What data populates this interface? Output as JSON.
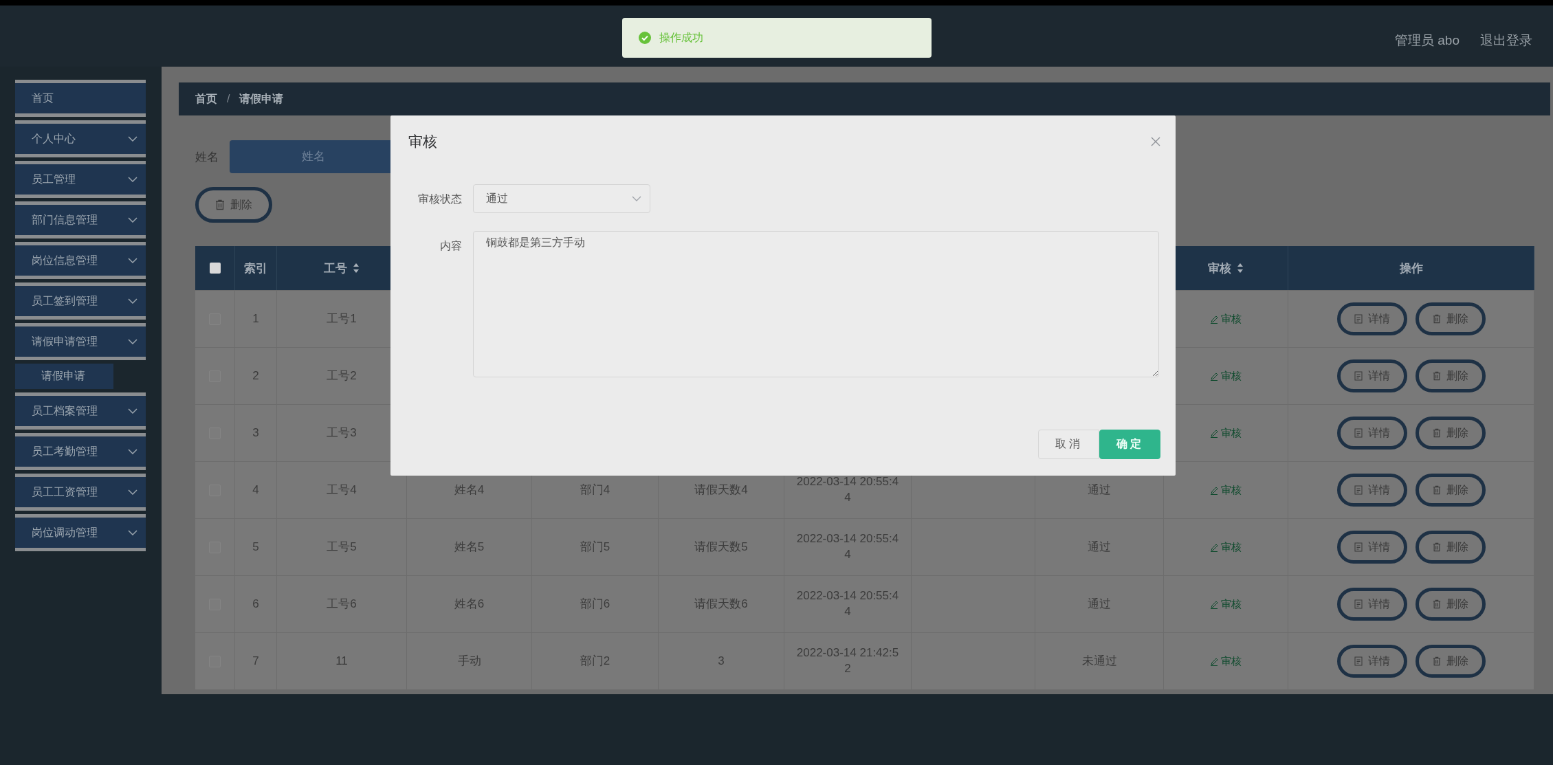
{
  "toast": {
    "message": "操作成功"
  },
  "header": {
    "user": "管理员 abo",
    "logout": "退出登录"
  },
  "sidebar": {
    "items": [
      {
        "label": "首页",
        "kind": "link"
      },
      {
        "label": "个人中心",
        "kind": "submenu"
      },
      {
        "label": "员工管理",
        "kind": "submenu"
      },
      {
        "label": "部门信息管理",
        "kind": "submenu"
      },
      {
        "label": "岗位信息管理",
        "kind": "submenu"
      },
      {
        "label": "员工签到管理",
        "kind": "submenu"
      },
      {
        "label": "请假申请管理",
        "kind": "submenu",
        "children": [
          {
            "label": "请假申请",
            "selected": true
          }
        ]
      },
      {
        "label": "员工档案管理",
        "kind": "submenu"
      },
      {
        "label": "员工考勤管理",
        "kind": "submenu"
      },
      {
        "label": "员工工资管理",
        "kind": "submenu"
      },
      {
        "label": "岗位调动管理",
        "kind": "submenu"
      }
    ]
  },
  "breadcrumb": {
    "items": [
      "首页",
      "请假申请"
    ],
    "separator": "/"
  },
  "search": {
    "label": "姓名",
    "placeholder": "姓名"
  },
  "toolbar": {
    "delete_button": "删除"
  },
  "table": {
    "header_checkbox": {
      "checked": false
    },
    "columns_left": [
      {
        "label": "索引",
        "sortable": false
      },
      {
        "label": "工号",
        "sortable": true
      }
    ],
    "columns_right": [
      {
        "label": "审核",
        "sortable": true
      },
      {
        "label": "操作",
        "sortable": false
      }
    ],
    "rows": [
      {
        "selected": false,
        "index": "1",
        "job_no": "工号1",
        "review": "审核",
        "detail": "详情",
        "delete": "删除"
      },
      {
        "selected": false,
        "index": "2",
        "job_no": "工号2",
        "review": "审核",
        "detail": "详情",
        "delete": "删除"
      },
      {
        "selected": false,
        "index": "3",
        "job_no": "工号3",
        "review": "审核",
        "detail": "详情",
        "delete": "删除"
      },
      {
        "selected": false,
        "index": "4",
        "job_no": "工号4",
        "name": "姓名4",
        "department": "部门4",
        "leave_days": "请假天数4",
        "apply_time": "2022-03-14 20:55:44",
        "status": "通过",
        "review": "审核",
        "detail": "详情",
        "delete": "删除"
      },
      {
        "selected": false,
        "index": "5",
        "job_no": "工号5",
        "name": "姓名5",
        "department": "部门5",
        "leave_days": "请假天数5",
        "apply_time": "2022-03-14 20:55:44",
        "status": "通过",
        "review": "审核",
        "detail": "详情",
        "delete": "删除"
      },
      {
        "selected": false,
        "index": "6",
        "job_no": "工号6",
        "name": "姓名6",
        "department": "部门6",
        "leave_days": "请假天数6",
        "apply_time": "2022-03-14 20:55:44",
        "status": "通过",
        "review": "审核",
        "detail": "详情",
        "delete": "删除"
      },
      {
        "selected": false,
        "index": "7",
        "job_no": "11",
        "name": "手动",
        "department": "部门2",
        "leave_days": "3",
        "apply_time": "2022-03-14 21:42:52",
        "status": "未通过",
        "review": "审核",
        "detail": "详情",
        "delete": "删除"
      }
    ]
  },
  "dialog": {
    "title": "审核",
    "fields": [
      {
        "kind": "select",
        "label": "审核状态",
        "value": "通过"
      },
      {
        "kind": "textarea",
        "label": "内容",
        "value": "铜鼓都是第三方手动"
      }
    ],
    "buttons": [
      {
        "kind": "default",
        "label": "取消"
      },
      {
        "kind": "primary",
        "label": "确定"
      }
    ]
  }
}
